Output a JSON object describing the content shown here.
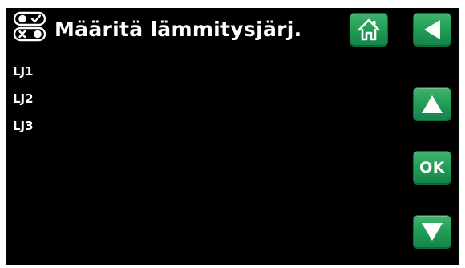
{
  "header": {
    "icon": "toggle-switches-icon",
    "title": "Määritä lämmitysjärj."
  },
  "menu": {
    "items": [
      {
        "label": "LJ1"
      },
      {
        "label": "LJ2"
      },
      {
        "label": "LJ3"
      }
    ]
  },
  "nav": {
    "home_icon": "home-icon",
    "back_icon": "back-arrow-icon",
    "up_icon": "arrow-up-icon",
    "ok_label": "OK",
    "down_icon": "arrow-down-icon"
  },
  "colors": {
    "background": "#000000",
    "button": "#1f9a54",
    "text": "#ffffff"
  }
}
